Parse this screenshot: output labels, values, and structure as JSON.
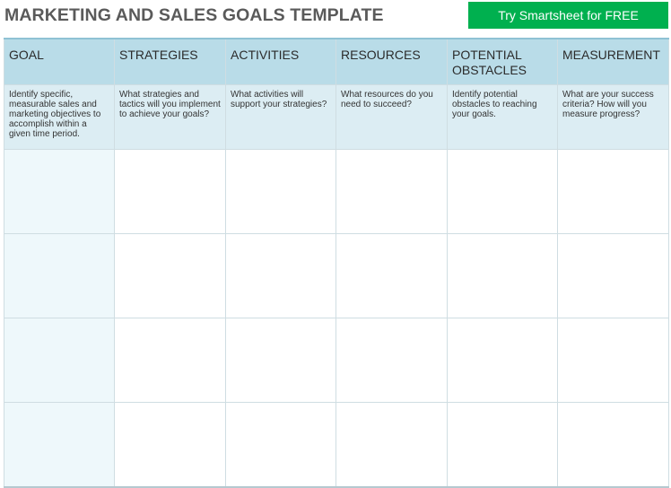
{
  "header": {
    "title": "MARKETING AND SALES GOALS TEMPLATE",
    "cta_label": "Try Smartsheet for FREE"
  },
  "columns": [
    {
      "label": "GOAL",
      "description": "Identify specific, measurable sales and marketing objectives to accomplish within a given time period."
    },
    {
      "label": "STRATEGIES",
      "description": "What strategies and tactics will you implement to achieve your goals?"
    },
    {
      "label": "ACTIVITIES",
      "description": "What activities will support your strategies?"
    },
    {
      "label": "RESOURCES",
      "description": "What resources do you need to succeed?"
    },
    {
      "label": "POTENTIAL OBSTACLES",
      "description": "Identify potential obstacles to reaching your goals."
    },
    {
      "label": "MEASUREMENT",
      "description": "What are your success criteria? How will you measure progress?"
    }
  ],
  "colors": {
    "cta_bg": "#00b04f",
    "header_bg": "#b9dce8",
    "description_bg": "#dcedf3",
    "goal_column_bg": "#eef8fb"
  }
}
